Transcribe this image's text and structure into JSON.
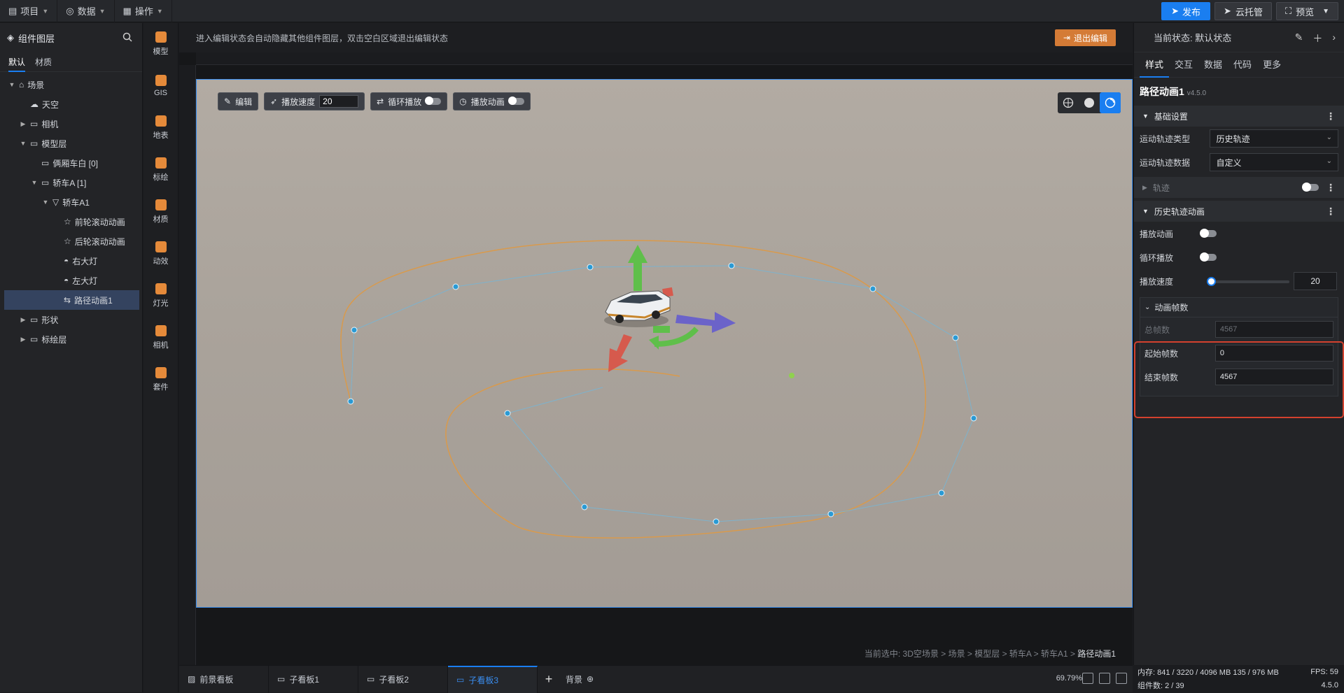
{
  "topbar": {
    "menus": [
      {
        "icon": "document-icon",
        "label": "项目"
      },
      {
        "icon": "database-icon",
        "label": "数据"
      },
      {
        "icon": "grid-icon",
        "label": "操作"
      }
    ],
    "publish_label": "发布",
    "cloud_label": "云托管",
    "preview_label": "预览"
  },
  "layers": {
    "title": "组件图层",
    "tabs": [
      "默认",
      "材质"
    ],
    "tree": [
      {
        "label": "场景",
        "indent": 0,
        "arrow": "▼",
        "icon": "scene-icon"
      },
      {
        "label": "天空",
        "indent": 1,
        "arrow": "",
        "icon": "sky-icon"
      },
      {
        "label": "相机",
        "indent": 1,
        "arrow": "▶",
        "icon": "folder-icon"
      },
      {
        "label": "模型层",
        "indent": 1,
        "arrow": "▼",
        "icon": "folder-icon"
      },
      {
        "label": "俩厢车白 [0]",
        "indent": 2,
        "arrow": "",
        "icon": "folder-icon"
      },
      {
        "label": "轿车A [1]",
        "indent": 2,
        "arrow": "▼",
        "icon": "folder-icon"
      },
      {
        "label": "轿车A1",
        "indent": 3,
        "arrow": "▼",
        "icon": "model-icon"
      },
      {
        "label": "前轮滚动动画",
        "indent": 4,
        "arrow": "",
        "icon": "star-icon"
      },
      {
        "label": "后轮滚动动画",
        "indent": 4,
        "arrow": "",
        "icon": "star-icon"
      },
      {
        "label": "右大灯",
        "indent": 4,
        "arrow": "",
        "icon": "light-icon"
      },
      {
        "label": "左大灯",
        "indent": 4,
        "arrow": "",
        "icon": "light-icon"
      },
      {
        "label": "路径动画1",
        "indent": 4,
        "arrow": "",
        "icon": "path-icon",
        "selected": true
      },
      {
        "label": "形状",
        "indent": 1,
        "arrow": "▶",
        "icon": "folder-icon"
      },
      {
        "label": "标绘层",
        "indent": 1,
        "arrow": "▶",
        "icon": "folder-icon"
      }
    ]
  },
  "iconbar": [
    {
      "label": "模型",
      "icon": "model-icon",
      "color": "#e58a3a"
    },
    {
      "label": "GIS",
      "icon": "globe-icon",
      "color": "#e58a3a"
    },
    {
      "label": "地表",
      "icon": "terrain-icon",
      "color": "#e58a3a"
    },
    {
      "label": "标绘",
      "icon": "pin-icon",
      "color": "#e58a3a"
    },
    {
      "label": "材质",
      "icon": "material-icon",
      "color": "#e58a3a"
    },
    {
      "label": "动效",
      "icon": "effect-icon",
      "color": "#e58a3a"
    },
    {
      "label": "灯光",
      "icon": "lamp-icon",
      "color": "#e58a3a"
    },
    {
      "label": "相机",
      "icon": "camera-icon",
      "color": "#e58a3a"
    },
    {
      "label": "套件",
      "icon": "kit-icon",
      "color": "#e58a3a"
    }
  ],
  "canvas": {
    "hint": "进入编辑状态会自动隐藏其他组件图层，双击空白区域退出编辑状态",
    "exit_label": "退出编辑",
    "toolbar": {
      "edit_label": "编辑",
      "speed_label": "播放速度",
      "speed_value": "20",
      "loop_label": "循环播放",
      "play_label": "播放动画"
    },
    "breadcrumb_prefix": "当前选中: 3D空场景 > 场景 > 模型层 > 轿车A > 轿车A1 > ",
    "breadcrumb_last": "路径动画1"
  },
  "bottom": {
    "tabs": [
      {
        "label": "前景看板",
        "icon": "board-icon",
        "active": false
      },
      {
        "label": "子看板1",
        "icon": "monitor-icon",
        "active": false
      },
      {
        "label": "子看板2",
        "icon": "monitor-icon",
        "active": false
      },
      {
        "label": "子看板3",
        "icon": "monitor-icon",
        "active": true
      }
    ],
    "add_label": "+",
    "background_label": "背景",
    "zoom": "69.79%"
  },
  "right": {
    "state_label": "当前状态: 默认状态",
    "tabs": [
      "样式",
      "交互",
      "数据",
      "代码",
      "更多"
    ],
    "component_name": "路径动画1",
    "version": "v4.5.0",
    "basic_section": "基础设置",
    "track_type_label": "运动轨迹类型",
    "track_type_value": "历史轨迹",
    "track_data_label": "运动轨迹数据",
    "track_data_value": "自定义",
    "track_section": "轨迹",
    "history_section": "历史轨迹动画",
    "play_anim_label": "播放动画",
    "loop_label": "循环播放",
    "speed_label": "播放速度",
    "speed_value": "20",
    "speed_fraction": 0.0,
    "frames_section": "动画帧数",
    "total_frames_label": "总帧数",
    "total_frames_value": "4567",
    "start_frame_label": "起始帧数",
    "start_frame_value": "0",
    "end_frame_label": "结束帧数",
    "end_frame_value": "4567"
  },
  "status": {
    "memory": "内存:  841 / 3220 / 4096 MB  135 / 976 MB",
    "fps": "FPS:  59",
    "components": "组件数: 2 / 39",
    "version": "4.5.0"
  }
}
